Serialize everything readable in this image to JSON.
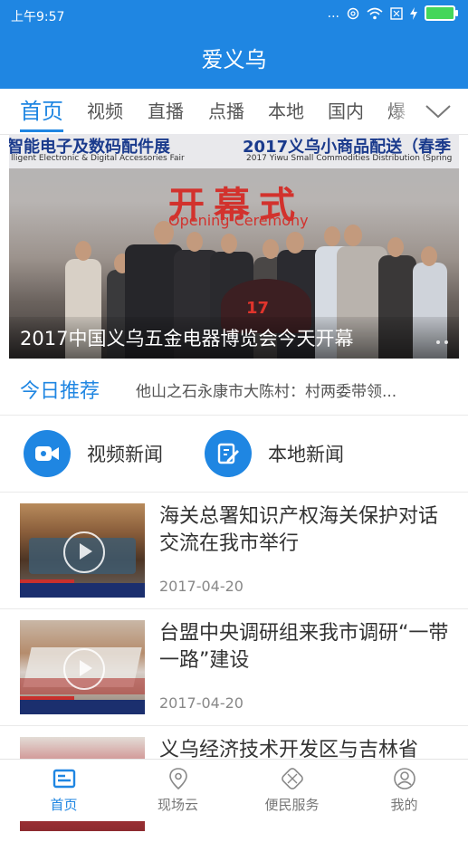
{
  "status_bar": {
    "time": "上午9:57",
    "dots": "...",
    "signal_icons": [
      "alarm-icon",
      "wifi-icon",
      "sim-icon",
      "charging-icon",
      "battery-icon"
    ]
  },
  "app": {
    "title": "爱义乌"
  },
  "tabs": [
    {
      "label": "首页",
      "active": true
    },
    {
      "label": "视频"
    },
    {
      "label": "直播"
    },
    {
      "label": "点播"
    },
    {
      "label": "本地"
    },
    {
      "label": "国内"
    },
    {
      "label": "爆"
    }
  ],
  "hero": {
    "banner_left": "智能电子及数码配件展",
    "banner_left_sub": "lligent Electronic & Digital Accessories Fair",
    "banner_right": "2017义乌小商品配送（春季",
    "banner_right_sub": "2017 Yiwu Small Commodities Distribution (Spring",
    "sign_cn": "开幕式",
    "sign_en": "Opening Ceremony",
    "caption": "2017中国义乌五金电器博览会今天开幕"
  },
  "recommend": {
    "label": "今日推荐",
    "text": "他山之石永康市大陈村：村两委带领..."
  },
  "shortcuts": [
    {
      "label": "视频新闻",
      "icon": "video-camera-icon"
    },
    {
      "label": "本地新闻",
      "icon": "edit-note-icon"
    }
  ],
  "news": [
    {
      "title": "海关总署知识产权海关保护对话交流在我市举行",
      "date": "2017-04-20",
      "has_video": true
    },
    {
      "title": "台盟中央调研组来我市调研“一带一路”建设",
      "date": "2017-04-20",
      "has_video": true
    },
    {
      "title": "义乌经济技术开发区与吉林省",
      "date": "",
      "has_video": false
    }
  ],
  "bottom_nav": [
    {
      "label": "首页",
      "icon": "home-icon",
      "active": true
    },
    {
      "label": "现场云",
      "icon": "location-icon"
    },
    {
      "label": "便民服务",
      "icon": "service-icon"
    },
    {
      "label": "我的",
      "icon": "user-icon"
    }
  ],
  "colors": {
    "primary": "#1f86e2",
    "battery": "#44d65a"
  }
}
